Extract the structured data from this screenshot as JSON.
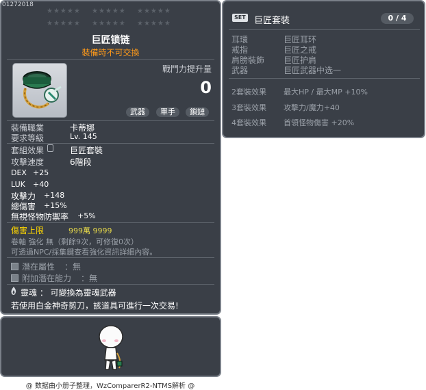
{
  "item": {
    "id_code": "01272018",
    "name": "巨匠锁链",
    "trade_note": "裝備時不可交換",
    "power_label": "戰鬥力提升量",
    "power_value": "0",
    "tags": [
      "武器",
      "單手",
      "鎖鏈"
    ],
    "job_label": "裝備職業",
    "job_value": "卡蒂娜",
    "level_label": "要求等級",
    "level_value": "Lv. 145",
    "set_label": "套組效果",
    "set_value": "巨匠套裝",
    "speed_label": "攻擊速度",
    "speed_value": "6階段",
    "stats": [
      {
        "label": "DEX",
        "value": "+25"
      },
      {
        "label": "LUK",
        "value": "+40"
      },
      {
        "label": "攻擊力",
        "value": "+148"
      },
      {
        "label": "總傷害",
        "value": "+15%"
      },
      {
        "label": "無視怪物防禦率",
        "value": "+5%"
      }
    ],
    "dmg_cap_label": "傷害上限",
    "dmg_cap_value": "999萬 9999",
    "scroll_line": "卷軸 強化 無（剩餘9次，可修復0次）",
    "npc_line": "可透過NPC/採集鍵查看強化資訊詳細內容。",
    "potential_label": "潛在屬性",
    "potential_value": "：無",
    "add_potential_label": "附加潛在能力",
    "add_potential_value": "：無",
    "soul_line": "靈魂 ： 可變換為靈魂武器",
    "trade_line": "若使用白金神奇剪刀，該道具可進行一次交易!"
  },
  "set_panel": {
    "badge": "SET",
    "name": "巨匠套裝",
    "count": "0 / 4",
    "pieces": [
      {
        "slot": "耳環",
        "name": "巨匠耳环"
      },
      {
        "slot": "戒指",
        "name": "巨匠之戒"
      },
      {
        "slot": "肩膀裝飾",
        "name": "巨匠护肩"
      },
      {
        "slot": "武器",
        "name": "巨匠武器中选一"
      }
    ],
    "effects": [
      {
        "tier": "2套裝效果",
        "text": "最大HP / 最大MP  +10%"
      },
      {
        "tier": "3套裝效果",
        "text": "攻擊力/魔力+40"
      },
      {
        "tier": "4套裝效果",
        "text": "首領怪物傷害  +20%"
      }
    ]
  },
  "footer": "@ 数据由小册子整理，WzComparerR2-NTMS解析 @",
  "colors": {
    "panel_bg": "#3a3f47",
    "trade_orange": "#ff9a1a",
    "dmg_yellow": "#ffd700",
    "dmg_value_yellow": "#e6d84a"
  }
}
